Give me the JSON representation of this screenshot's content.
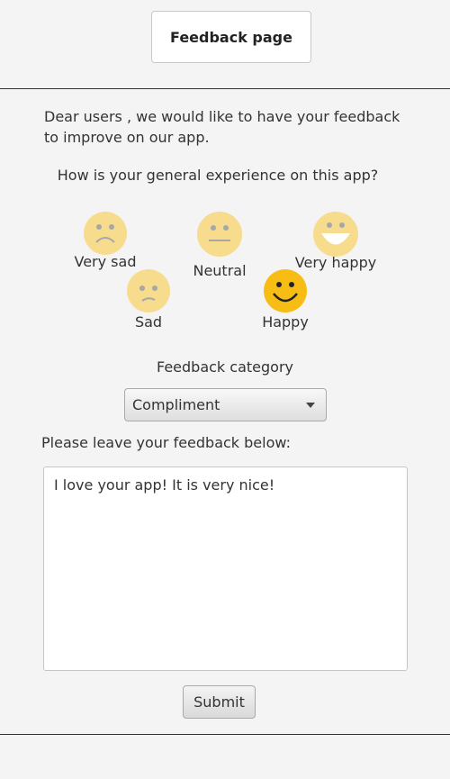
{
  "header": {
    "title": "Feedback page"
  },
  "intro": {
    "text": "Dear users , we would like to have your feedback to improve on our app."
  },
  "question": {
    "text": "How is your general experience on this app?"
  },
  "moods": {
    "selected": "Happy",
    "very_sad": {
      "label": "Very sad",
      "icon": "very-sad-face-icon"
    },
    "neutral": {
      "label": "Neutral",
      "icon": "neutral-face-icon"
    },
    "very_happy": {
      "label": "Very happy",
      "icon": "very-happy-face-icon"
    },
    "sad": {
      "label": "Sad",
      "icon": "sad-face-icon"
    },
    "happy": {
      "label": "Happy",
      "icon": "happy-face-icon"
    }
  },
  "category": {
    "label": "Feedback category",
    "selected": "Compliment"
  },
  "feedback": {
    "label": "Please leave your feedback below:",
    "value": "I love your app! It is very nice!"
  },
  "submit": {
    "label": "Submit"
  },
  "colors": {
    "face_inactive": "#f7dc8e",
    "face_active": "#f7bd15",
    "face_features": "#a7a7a7",
    "face_features_active": "#222222"
  }
}
